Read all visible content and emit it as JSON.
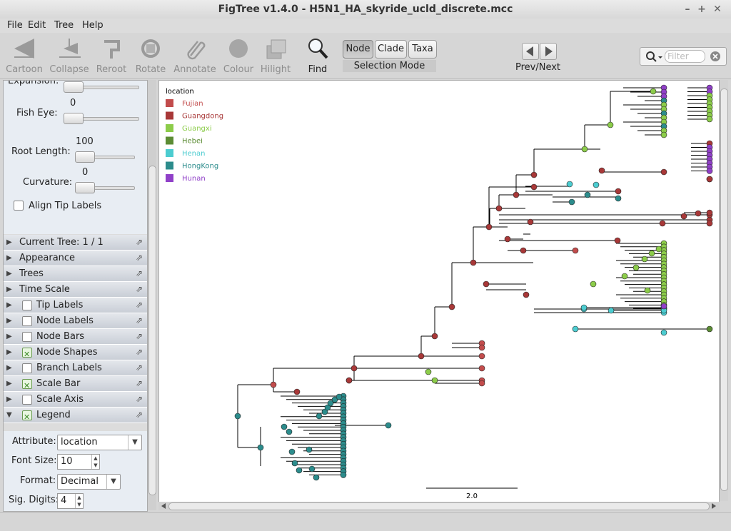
{
  "window": {
    "title": "FigTree v1.4.0 - H5N1_HA_skyride_ucld_discrete.mcc"
  },
  "menu": {
    "file": "File",
    "edit": "Edit",
    "tree": "Tree",
    "help": "Help"
  },
  "toolbar": {
    "cartoon": "Cartoon",
    "collapse": "Collapse",
    "reroot": "Reroot",
    "rotate": "Rotate",
    "annotate": "Annotate",
    "colour": "Colour",
    "hilight": "Hilight",
    "find": "Find",
    "node": "Node",
    "clade": "Clade",
    "taxa": "Taxa",
    "selection_mode": "Selection Mode",
    "prev_next": "Prev/Next",
    "filter_placeholder": "Filter"
  },
  "panel": {
    "expansion_label": "Expansion:",
    "fisheye_value": "0",
    "fisheye_label": "Fish Eye:",
    "root_length_value": "100",
    "root_length_label": "Root Length:",
    "curvature_value": "0",
    "curvature_label": "Curvature:",
    "align_tip_labels": "Align Tip Labels",
    "sections": [
      {
        "label": "Current Tree: 1 / 1",
        "checkbox": "none",
        "expanded": false
      },
      {
        "label": "Appearance",
        "checkbox": "none",
        "expanded": false
      },
      {
        "label": "Trees",
        "checkbox": "none",
        "expanded": false
      },
      {
        "label": "Time Scale",
        "checkbox": "none",
        "expanded": false
      },
      {
        "label": "Tip Labels",
        "checkbox": "off",
        "expanded": false
      },
      {
        "label": "Node Labels",
        "checkbox": "off",
        "expanded": false
      },
      {
        "label": "Node Bars",
        "checkbox": "off",
        "expanded": false
      },
      {
        "label": "Node Shapes",
        "checkbox": "on",
        "expanded": false
      },
      {
        "label": "Branch Labels",
        "checkbox": "off",
        "expanded": false
      },
      {
        "label": "Scale Bar",
        "checkbox": "on",
        "expanded": false
      },
      {
        "label": "Scale Axis",
        "checkbox": "off",
        "expanded": false
      },
      {
        "label": "Legend",
        "checkbox": "on",
        "expanded": true
      }
    ],
    "legend": {
      "attribute_label": "Attribute:",
      "attribute_value": "location",
      "font_size_label": "Font Size:",
      "font_size_value": "10",
      "format_label": "Format:",
      "format_value": "Decimal",
      "sig_digits_label": "Sig. Digits:",
      "sig_digits_value": "4"
    }
  },
  "tree": {
    "legend_title": "location",
    "legend": [
      {
        "name": "Fujian",
        "color": "#c24c4c"
      },
      {
        "name": "Guangdong",
        "color": "#a83838"
      },
      {
        "name": "Guangxi",
        "color": "#8ccc4a"
      },
      {
        "name": "Hebei",
        "color": "#5c8c34"
      },
      {
        "name": "Henan",
        "color": "#4cccd0"
      },
      {
        "name": "HongKong",
        "color": "#2c8c8c"
      },
      {
        "name": "Hunan",
        "color": "#9040c8"
      }
    ],
    "scale_bar_label": "2.0"
  }
}
